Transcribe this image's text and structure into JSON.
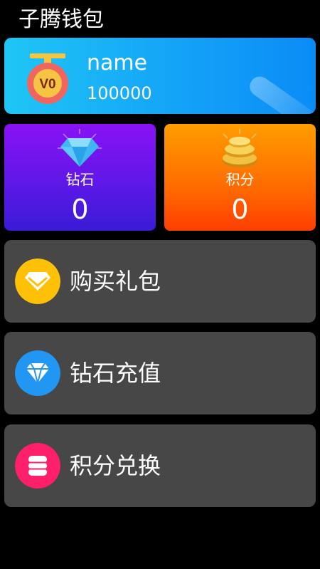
{
  "app": {
    "title": "子腾钱包"
  },
  "profile": {
    "level_badge": "V0",
    "name": "name",
    "balance": "100000",
    "colors": {
      "card_start": "#1fc6f5",
      "card_end": "#0a8cf7"
    }
  },
  "stats": {
    "diamond": {
      "label": "钻石",
      "value": "0",
      "icon": "diamond-icon",
      "color": "#6a14ee"
    },
    "points": {
      "label": "积分",
      "value": "0",
      "icon": "coin-stack-icon",
      "color": "#ff7a00"
    }
  },
  "menu": [
    {
      "label": "购买礼包",
      "icon": "gift-diamond-icon",
      "color": "#ffc107"
    },
    {
      "label": "钻石充值",
      "icon": "diamond-icon",
      "color": "#2196f3"
    },
    {
      "label": "积分兑换",
      "icon": "database-icon",
      "color": "#ff1f6b"
    }
  ]
}
